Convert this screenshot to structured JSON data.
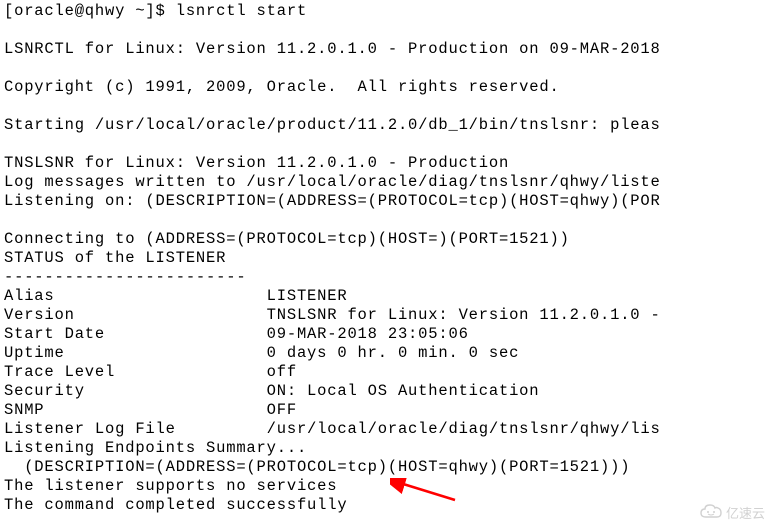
{
  "terminal": {
    "lines": [
      "[oracle@qhwy ~]$ lsnrctl start",
      "",
      "LSNRCTL for Linux: Version 11.2.0.1.0 - Production on 09-MAR-2018",
      "",
      "Copyright (c) 1991, 2009, Oracle.  All rights reserved.",
      "",
      "Starting /usr/local/oracle/product/11.2.0/db_1/bin/tnslsnr: pleas",
      "",
      "TNSLSNR for Linux: Version 11.2.0.1.0 - Production",
      "Log messages written to /usr/local/oracle/diag/tnslsnr/qhwy/liste",
      "Listening on: (DESCRIPTION=(ADDRESS=(PROTOCOL=tcp)(HOST=qhwy)(POR",
      "",
      "Connecting to (ADDRESS=(PROTOCOL=tcp)(HOST=)(PORT=1521))",
      "STATUS of the LISTENER",
      "------------------------",
      "Alias                     LISTENER",
      "Version                   TNSLSNR for Linux: Version 11.2.0.1.0 -",
      "Start Date                09-MAR-2018 23:05:06",
      "Uptime                    0 days 0 hr. 0 min. 0 sec",
      "Trace Level               off",
      "Security                  ON: Local OS Authentication",
      "SNMP                      OFF",
      "Listener Log File         /usr/local/oracle/diag/tnslsnr/qhwy/lis",
      "Listening Endpoints Summary...",
      "  (DESCRIPTION=(ADDRESS=(PROTOCOL=tcp)(HOST=qhwy)(PORT=1521)))",
      "The listener supports no services",
      "The command completed successfully"
    ]
  },
  "arrow": {
    "color": "#ff0000"
  },
  "watermark": {
    "text": "亿速云",
    "icon": "cloud"
  }
}
